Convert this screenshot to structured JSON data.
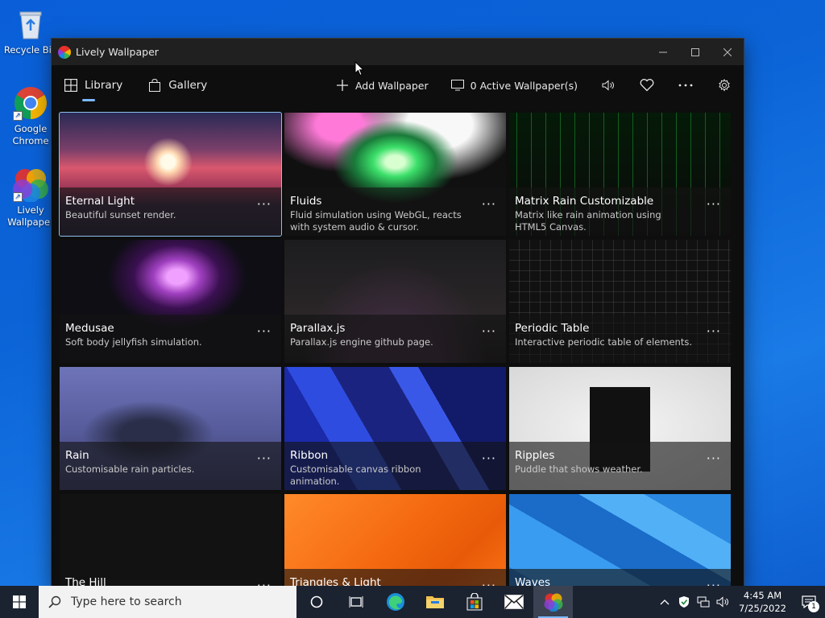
{
  "desktop": {
    "icons": [
      {
        "label": "Recycle Bin"
      },
      {
        "label": "Google Chrome"
      },
      {
        "label": "Lively Wallpaper"
      }
    ]
  },
  "window": {
    "title": "Lively Wallpaper",
    "nav": {
      "library": "Library",
      "gallery": "Gallery",
      "add_wallpaper": "Add Wallpaper",
      "active_wallpapers": "0 Active Wallpaper(s)"
    }
  },
  "wallpapers": [
    {
      "name": "Eternal Light",
      "desc": "Beautiful sunset render.",
      "more": "···"
    },
    {
      "name": "Fluids",
      "desc": "Fluid simulation using WebGL, reacts with system audio & cursor.",
      "more": "···"
    },
    {
      "name": "Matrix Rain Customizable",
      "desc": "Matrix like rain animation using HTML5 Canvas.",
      "more": "···"
    },
    {
      "name": "Medusae",
      "desc": "Soft body jellyfish simulation.",
      "more": "···"
    },
    {
      "name": "Parallax.js",
      "desc": "Parallax.js engine github page.",
      "more": "···"
    },
    {
      "name": "Periodic Table",
      "desc": "Interactive periodic table of elements.",
      "more": "···"
    },
    {
      "name": "Rain",
      "desc": "Customisable rain particles.",
      "more": "···"
    },
    {
      "name": "Ribbon",
      "desc": "Customisable canvas ribbon animation.",
      "more": "···"
    },
    {
      "name": "Ripples",
      "desc": "Puddle that shows weather.",
      "more": "···"
    },
    {
      "name": "The Hill",
      "desc": "",
      "more": "···"
    },
    {
      "name": "Triangles & Light",
      "desc": "",
      "more": "···"
    },
    {
      "name": "Waves",
      "desc": "",
      "more": "···"
    }
  ],
  "taskbar": {
    "search_placeholder": "Type here to search",
    "time": "4:45 AM",
    "date": "7/25/2022",
    "notification_count": "1"
  },
  "colors": {
    "accent": "#7ab8ff",
    "window_bg": "#0e0e0e",
    "titlebar_bg": "#202020",
    "taskbar_bg": "#1b2230",
    "desktop_bg": "#0b63d6"
  }
}
